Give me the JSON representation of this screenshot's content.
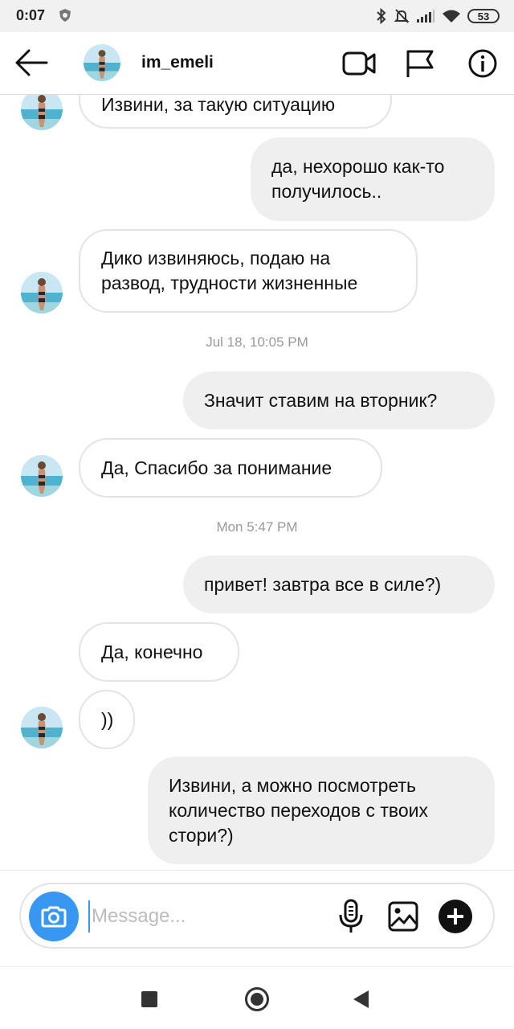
{
  "status_bar": {
    "time": "0:07",
    "battery": "53"
  },
  "header": {
    "username": "im_emeli",
    "icons": [
      "back-arrow-icon",
      "avatar",
      "video-call-icon",
      "flag-icon",
      "info-icon"
    ]
  },
  "messages": [
    {
      "direction": "in",
      "text": "Извини, за такую ситуацию"
    },
    {
      "direction": "out",
      "lines": [
        "да, нехорошо как-то",
        "получилось.."
      ]
    },
    {
      "direction": "in",
      "lines": [
        "Дико извиняюсь, подаю на",
        "развод, трудности жизненные"
      ]
    },
    {
      "type": "timestamp",
      "text": "Jul 18, 10:05 PM"
    },
    {
      "direction": "out",
      "text": "Значит ставим на вторник?"
    },
    {
      "direction": "in",
      "text": "Да, Спасибо за понимание"
    },
    {
      "type": "timestamp",
      "text": "Mon 5:47 PM"
    },
    {
      "direction": "out",
      "text": "привет! завтра все в силе?)"
    },
    {
      "direction": "in",
      "text": "Да, конечно"
    },
    {
      "direction": "in",
      "text": "))"
    },
    {
      "direction": "out",
      "lines": [
        "Извини, а можно посмотреть",
        "количество переходов с твоих",
        "стори?)"
      ]
    }
  ],
  "composer": {
    "placeholder": "Message..."
  },
  "colors": {
    "accent": "#3897f0",
    "outgoing_bubble": "#efefef",
    "incoming_border": "#e4e4e4"
  }
}
